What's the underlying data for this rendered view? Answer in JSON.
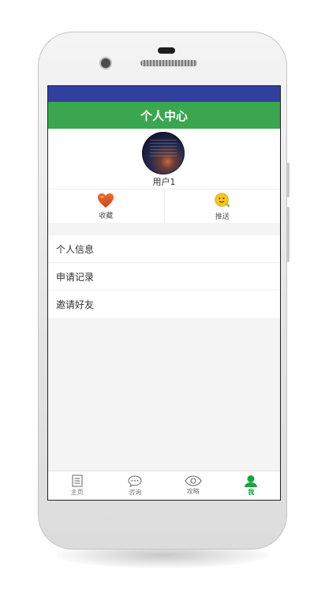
{
  "header": {
    "title": "个人中心"
  },
  "profile": {
    "username": "用户1"
  },
  "actions": [
    {
      "label": "收藏",
      "icon": "heart-icon"
    },
    {
      "label": "推送",
      "icon": "smiley-icon"
    }
  ],
  "menu": [
    {
      "label": "个人信息"
    },
    {
      "label": "申请记录"
    },
    {
      "label": "邀请好友"
    }
  ],
  "tabbar": [
    {
      "label": "主页",
      "icon": "document-icon",
      "active": false
    },
    {
      "label": "咨询",
      "icon": "chat-icon",
      "active": false
    },
    {
      "label": "攻略",
      "icon": "eye-icon",
      "active": false
    },
    {
      "label": "我",
      "icon": "person-icon",
      "active": true
    }
  ],
  "colors": {
    "status_bar": "#31409e",
    "title_bar": "#3aa64f",
    "active_tab": "#1aa23d"
  }
}
